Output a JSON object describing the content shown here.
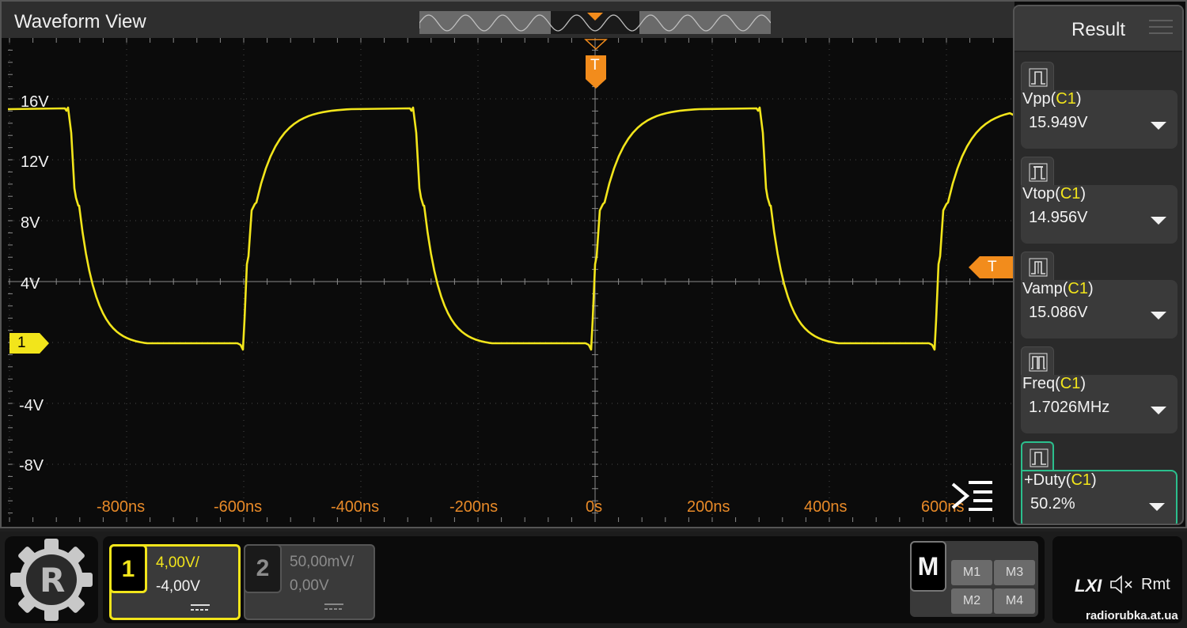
{
  "waveform": {
    "title": "Waveform View",
    "y_labels": [
      "16V",
      "12V",
      "8V",
      "4V",
      "-4V",
      "-8V"
    ],
    "time_labels": [
      "-800ns",
      "-600ns",
      "-400ns",
      "-200ns",
      "0s",
      "200ns",
      "400ns",
      "600ns"
    ],
    "channel_marker": "1",
    "trigger_marker": "T",
    "trace_color": "#f2e51b"
  },
  "result_panel": {
    "title": "Result",
    "measurements": [
      {
        "name": "Vpp(",
        "source": "C1",
        "close": ")",
        "value": "15.949V"
      },
      {
        "name": "Vtop(",
        "source": "C1",
        "close": ")",
        "value": "14.956V"
      },
      {
        "name": "Vamp(",
        "source": "C1",
        "close": ")",
        "value": "15.086V"
      },
      {
        "name": "Freq(",
        "source": "C1",
        "close": ")",
        "value": "1.7026MHz"
      },
      {
        "name": "+Duty(",
        "source": "C1",
        "close": ")",
        "value": "50.2%"
      }
    ]
  },
  "channels": [
    {
      "number": "1",
      "scale": "4,00V/",
      "offset": "-4,00V"
    },
    {
      "number": "2",
      "scale": "50,00mV/",
      "offset": "0,00V"
    }
  ],
  "math": {
    "label": "M",
    "buttons": [
      "M1",
      "M3",
      "M2",
      "M4"
    ]
  },
  "status": {
    "lxi": "LXI",
    "rmt": "Rmt"
  },
  "watermark": "radiorubka.at.ua"
}
